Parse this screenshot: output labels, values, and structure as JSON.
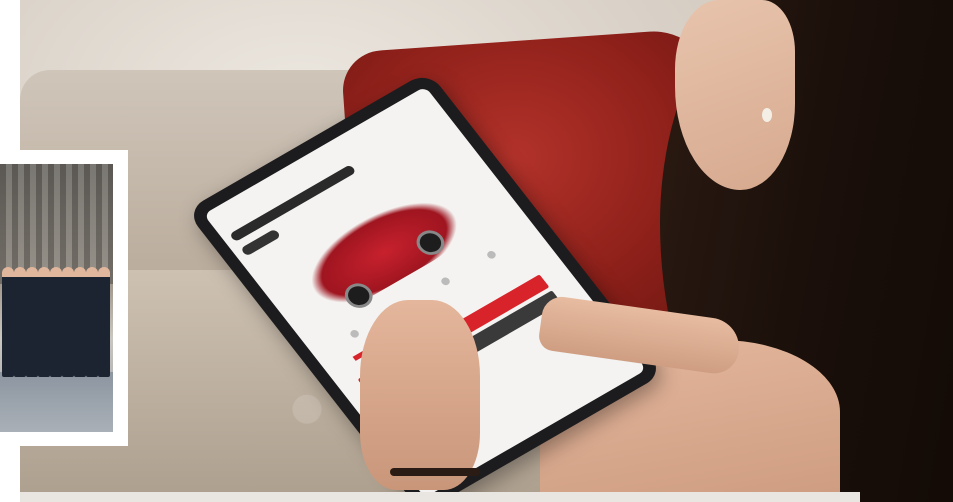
{
  "scene": {
    "description_colors": {
      "tablet_accent": "#d8232a",
      "car": "#c7212d",
      "pillow": "#b2322a"
    }
  },
  "inset_photo": {
    "people_count": 9
  }
}
